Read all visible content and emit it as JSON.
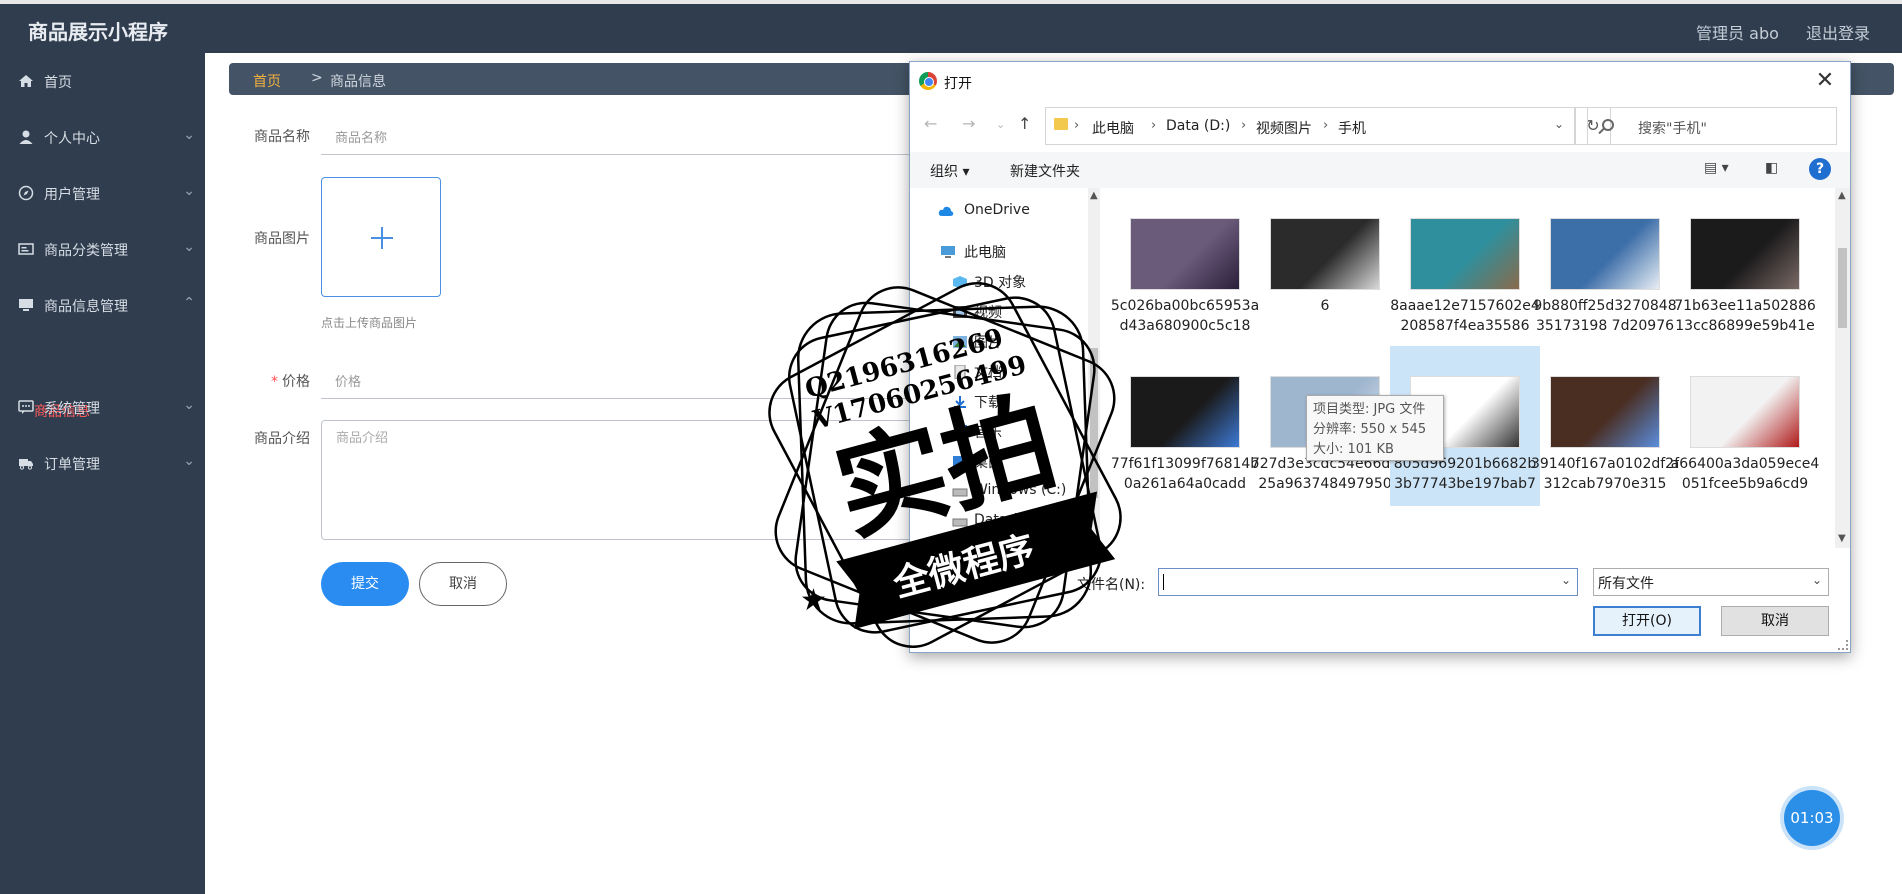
{
  "app": {
    "title": "商品展示小程序",
    "admin_label": "管理员 abo",
    "logout_label": "退出登录"
  },
  "sidebar": {
    "items": [
      {
        "label": "首页",
        "icon": "home-icon",
        "expandable": false
      },
      {
        "label": "个人中心",
        "icon": "user-icon",
        "expandable": true
      },
      {
        "label": "用户管理",
        "icon": "compass-icon",
        "expandable": true
      },
      {
        "label": "商品分类管理",
        "icon": "id-card-icon",
        "expandable": true
      },
      {
        "label": "商品信息管理",
        "icon": "monitor-icon",
        "expandable": true,
        "expanded": true
      },
      {
        "label": "系统管理",
        "icon": "chat-icon",
        "expandable": true
      },
      {
        "label": "订单管理",
        "icon": "truck-icon",
        "expandable": true
      }
    ],
    "active_sub": "商品信息",
    "active_color": "#ff5b5b"
  },
  "breadcrumb": {
    "home": "首页",
    "sep": ">",
    "current": "商品信息"
  },
  "form": {
    "name_label": "商品名称",
    "name_placeholder": "商品名称",
    "image_label": "商品图片",
    "upload_hint": "点击上传商品图片",
    "price_required": "*",
    "price_label": "价格",
    "price_placeholder": "价格",
    "desc_label": "商品介绍",
    "desc_placeholder": "商品介绍",
    "submit_label": "提交",
    "cancel_label": "取消"
  },
  "timer": "01:03",
  "dialog": {
    "title": "打开",
    "close": "✕",
    "address": [
      "此电脑",
      "Data (D:)",
      "视频图片",
      "手机"
    ],
    "search_placeholder": "搜索\"手机\"",
    "organize_label": "组织 ▾",
    "new_folder_label": "新建文件夹",
    "help_label": "?",
    "nav_pane": [
      {
        "label": "OneDrive",
        "icon": "cloud-icon"
      },
      {
        "label": "此电脑",
        "icon": "computer-icon"
      },
      {
        "label": "3D 对象",
        "icon": "cube-icon"
      },
      {
        "label": "视频",
        "icon": "film-icon"
      },
      {
        "label": "图片",
        "icon": "picture-icon"
      },
      {
        "label": "文档",
        "icon": "document-icon"
      },
      {
        "label": "下载",
        "icon": "download-icon"
      },
      {
        "label": "音乐",
        "icon": "music-icon"
      },
      {
        "label": "桌面",
        "icon": "desktop-icon"
      },
      {
        "label": "Windows (C:)",
        "icon": "drive-icon"
      },
      {
        "label": "Data (D:)",
        "icon": "drive-icon"
      }
    ],
    "files": [
      {
        "name": "5c026ba00bc65953ad43a680900c5c18",
        "colors": [
          "#6b5b7b",
          "#2a1f3a"
        ]
      },
      {
        "name": "6",
        "colors": [
          "#2b2b2b",
          "#d9d9d9"
        ]
      },
      {
        "name": "8aaae12e7157602e4208587f4ea35586",
        "colors": [
          "#2f8f9d",
          "#8a6a4a"
        ]
      },
      {
        "name": "9b880ff25d327084835173198 7d20976",
        "colors": [
          "#3c6ea8",
          "#e8eef5"
        ]
      },
      {
        "name": "71b63ee11a50288613cc86899e59b41e",
        "colors": [
          "#1b1b1b",
          "#7a6a66"
        ]
      },
      {
        "name": "77f61f13099f76814b0a261a64a0cadd",
        "colors": [
          "#1a1a1a",
          "#3d7ad6"
        ]
      },
      {
        "name": "727d3e3cdc54e66d625a963748497950",
        "colors": [
          "#9fb6cf",
          "#e3e8ee"
        ]
      },
      {
        "name": "805d969201b6682b3b77743be197bab7",
        "colors": [
          "#ffffff",
          "#333333"
        ]
      },
      {
        "name": "39140f167a0102df2f312cab7970e315",
        "colors": [
          "#4a2e22",
          "#5b8ede"
        ]
      },
      {
        "name": "a66400a3da059ece4051fcee5b9a6cd9",
        "colors": [
          "#f2f2f2",
          "#b01a1a"
        ]
      }
    ],
    "selected_index": 7,
    "tooltip": {
      "type": "项目类型: JPG 文件",
      "dims": "分辨率: 550 x 545",
      "size": "大小: 101 KB"
    },
    "filename_label": "文件名(N):",
    "filename_value": "",
    "filetype_value": "所有文件",
    "open_label": "打开(O)",
    "cancel_label": "取消"
  },
  "watermark": {
    "line1": "Q2196316269",
    "line2": "V17060256499",
    "big": "实拍",
    "banner": "全微程序"
  }
}
